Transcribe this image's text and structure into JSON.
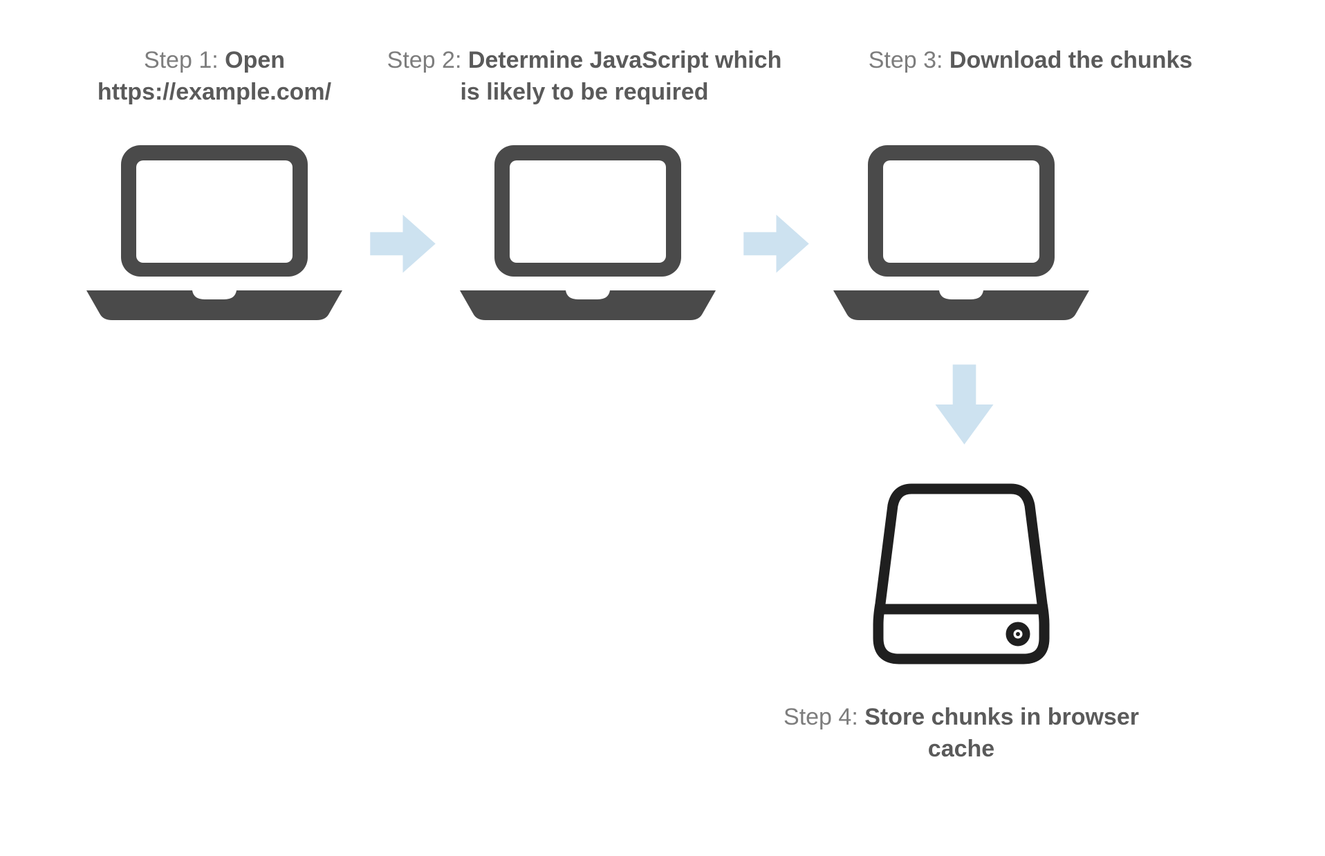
{
  "steps": [
    {
      "prefix": "Step 1: ",
      "bold": "Open https://example.com/"
    },
    {
      "prefix": "Step 2: ",
      "bold": "Determine JavaScript which is likely to be required"
    },
    {
      "prefix": "Step 3: ",
      "bold": "Download the chunks"
    },
    {
      "prefix": "Step 4: ",
      "bold": "Store chunks in browser cache"
    }
  ],
  "colors": {
    "icon_dark": "#4a4a4a",
    "arrow": "#cde2f0",
    "drive_stroke": "#1f1f1f"
  }
}
